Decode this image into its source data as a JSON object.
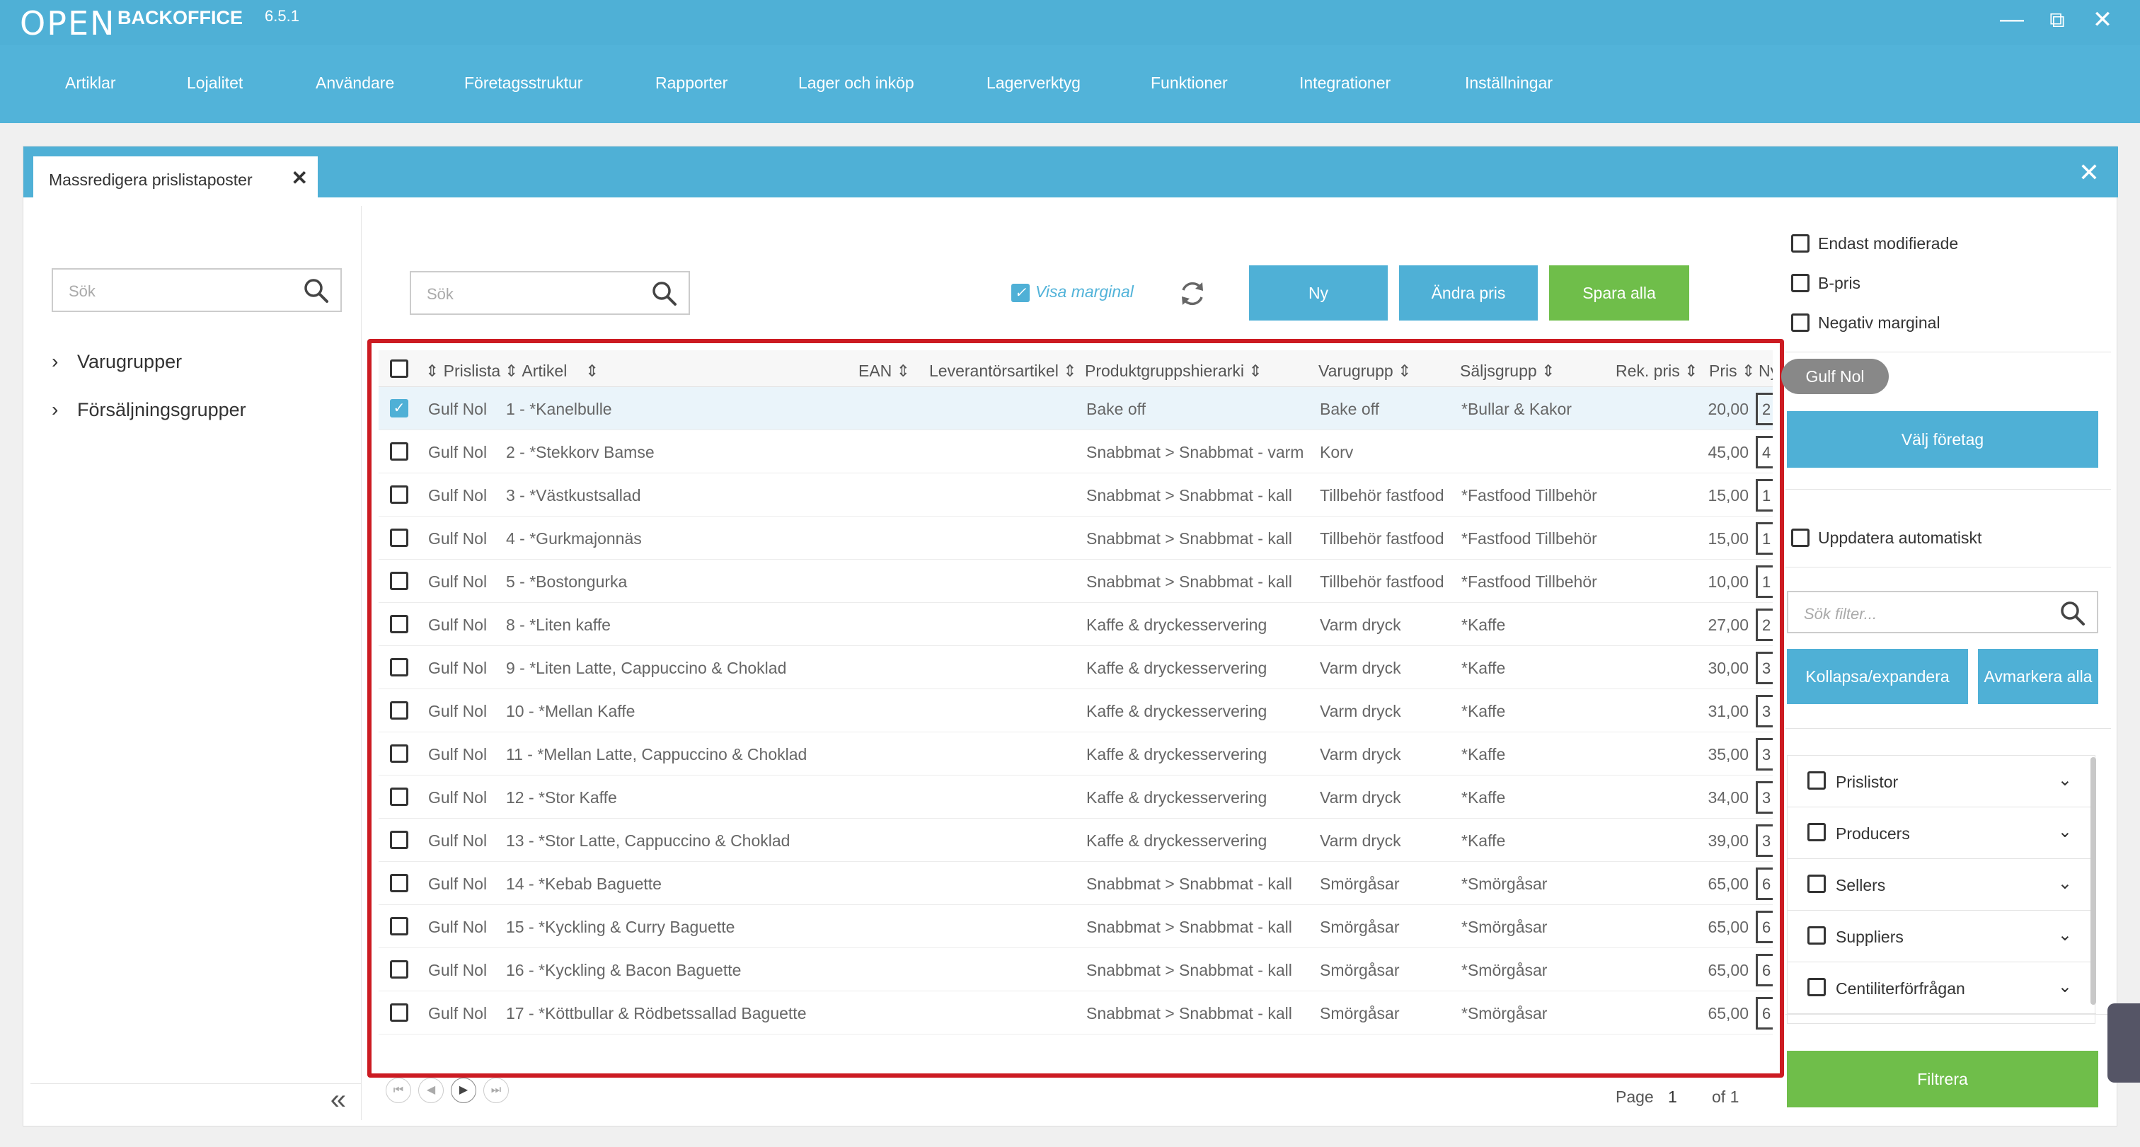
{
  "app": {
    "logo_text": "OPEN",
    "brand": "BACKOFFICE",
    "version": "6.5.1"
  },
  "nav": {
    "items": [
      "Artiklar",
      "Lojalitet",
      "Användare",
      "Företagsstruktur",
      "Rapporter",
      "Lager och inköp",
      "Lagerverktyg",
      "Funktioner",
      "Integrationer",
      "Inställningar"
    ]
  },
  "tab": {
    "title": "Massredigera prislistaposter"
  },
  "left": {
    "search_placeholder": "Sök",
    "tree": [
      "Varugrupper",
      "Försäljningsgrupper"
    ]
  },
  "toolbar": {
    "search_placeholder": "Sök",
    "visa_marginal": "Visa marginal",
    "btn_ny": "Ny",
    "btn_andra_pris": "Ändra pris",
    "btn_spara_alla": "Spara alla"
  },
  "grid": {
    "columns": [
      "Prislista",
      "Artikel",
      "EAN",
      "Leverantörsartikel",
      "Produktgruppshierarki",
      "Varugrupp",
      "Säljsgrupp",
      "Rek. pris",
      "Pris",
      "Ny"
    ],
    "rows": [
      {
        "prislista": "Gulf Nol",
        "artikel": "1 - *Kanelbulle",
        "hierarki": "Bake off",
        "varugrupp": "Bake off",
        "saljgrupp": "*Bullar & Kakor",
        "pris": "20,00",
        "ny": "2",
        "selected": true
      },
      {
        "prislista": "Gulf Nol",
        "artikel": "2 - *Stekkorv Bamse",
        "hierarki": "Snabbmat > Snabbmat - varm",
        "varugrupp": "Korv",
        "saljgrupp": "",
        "pris": "45,00",
        "ny": "4",
        "selected": false
      },
      {
        "prislista": "Gulf Nol",
        "artikel": "3 - *Västkustsallad",
        "hierarki": "Snabbmat > Snabbmat - kall",
        "varugrupp": "Tillbehör fastfood",
        "saljgrupp": "*Fastfood Tillbehör",
        "pris": "15,00",
        "ny": "1",
        "selected": false
      },
      {
        "prislista": "Gulf Nol",
        "artikel": "4 - *Gurkmajonnäs",
        "hierarki": "Snabbmat > Snabbmat - kall",
        "varugrupp": "Tillbehör fastfood",
        "saljgrupp": "*Fastfood Tillbehör",
        "pris": "15,00",
        "ny": "1",
        "selected": false
      },
      {
        "prislista": "Gulf Nol",
        "artikel": "5 - *Bostongurka",
        "hierarki": "Snabbmat > Snabbmat - kall",
        "varugrupp": "Tillbehör fastfood",
        "saljgrupp": "*Fastfood Tillbehör",
        "pris": "10,00",
        "ny": "1",
        "selected": false
      },
      {
        "prislista": "Gulf Nol",
        "artikel": "8 - *Liten kaffe",
        "hierarki": "Kaffe & dryckesservering",
        "varugrupp": "Varm dryck",
        "saljgrupp": "*Kaffe",
        "pris": "27,00",
        "ny": "2",
        "selected": false
      },
      {
        "prislista": "Gulf Nol",
        "artikel": "9 - *Liten Latte, Cappuccino & Choklad",
        "hierarki": "Kaffe & dryckesservering",
        "varugrupp": "Varm dryck",
        "saljgrupp": "*Kaffe",
        "pris": "30,00",
        "ny": "3",
        "selected": false
      },
      {
        "prislista": "Gulf Nol",
        "artikel": "10 - *Mellan Kaffe",
        "hierarki": "Kaffe & dryckesservering",
        "varugrupp": "Varm dryck",
        "saljgrupp": "*Kaffe",
        "pris": "31,00",
        "ny": "3",
        "selected": false
      },
      {
        "prislista": "Gulf Nol",
        "artikel": "11 - *Mellan Latte, Cappuccino & Choklad",
        "hierarki": "Kaffe & dryckesservering",
        "varugrupp": "Varm dryck",
        "saljgrupp": "*Kaffe",
        "pris": "35,00",
        "ny": "3",
        "selected": false
      },
      {
        "prislista": "Gulf Nol",
        "artikel": "12 - *Stor Kaffe",
        "hierarki": "Kaffe & dryckesservering",
        "varugrupp": "Varm dryck",
        "saljgrupp": "*Kaffe",
        "pris": "34,00",
        "ny": "3",
        "selected": false
      },
      {
        "prislista": "Gulf Nol",
        "artikel": "13 - *Stor Latte, Cappuccino & Choklad",
        "hierarki": "Kaffe & dryckesservering",
        "varugrupp": "Varm dryck",
        "saljgrupp": "*Kaffe",
        "pris": "39,00",
        "ny": "3",
        "selected": false
      },
      {
        "prislista": "Gulf Nol",
        "artikel": "14 - *Kebab Baguette",
        "hierarki": "Snabbmat > Snabbmat - kall",
        "varugrupp": "Smörgåsar",
        "saljgrupp": "*Smörgåsar",
        "pris": "65,00",
        "ny": "6",
        "selected": false
      },
      {
        "prislista": "Gulf Nol",
        "artikel": "15 - *Kyckling & Curry Baguette",
        "hierarki": "Snabbmat > Snabbmat - kall",
        "varugrupp": "Smörgåsar",
        "saljgrupp": "*Smörgåsar",
        "pris": "65,00",
        "ny": "6",
        "selected": false
      },
      {
        "prislista": "Gulf Nol",
        "artikel": "16 - *Kyckling & Bacon Baguette",
        "hierarki": "Snabbmat > Snabbmat - kall",
        "varugrupp": "Smörgåsar",
        "saljgrupp": "*Smörgåsar",
        "pris": "65,00",
        "ny": "6",
        "selected": false
      },
      {
        "prislista": "Gulf Nol",
        "artikel": "17 - *Köttbullar & Rödbetssallad Baguette",
        "hierarki": "Snabbmat > Snabbmat - kall",
        "varugrupp": "Smörgåsar",
        "saljgrupp": "*Smörgåsar",
        "pris": "65,00",
        "ny": "6",
        "selected": false
      }
    ]
  },
  "pager": {
    "page_label": "Page",
    "page": "1",
    "of_label": "of 1"
  },
  "right": {
    "checks": [
      "Endast modifierade",
      "B-pris",
      "Negativ marginal"
    ],
    "chip": "Gulf Nol",
    "valj_foretag": "Välj företag",
    "uppdatera": "Uppdatera automatiskt",
    "filter_placeholder": "Sök filter...",
    "kollapsa": "Kollapsa/expandera",
    "avmarkera": "Avmarkera alla",
    "filters": [
      "Prislistor",
      "Producers",
      "Sellers",
      "Suppliers",
      "Centiliterförfrågan"
    ],
    "filtrera": "Filtrera"
  },
  "colors": {
    "primary": "#4fb0d6",
    "green": "#6fbe4a",
    "highlight_border": "#cc1b22"
  }
}
